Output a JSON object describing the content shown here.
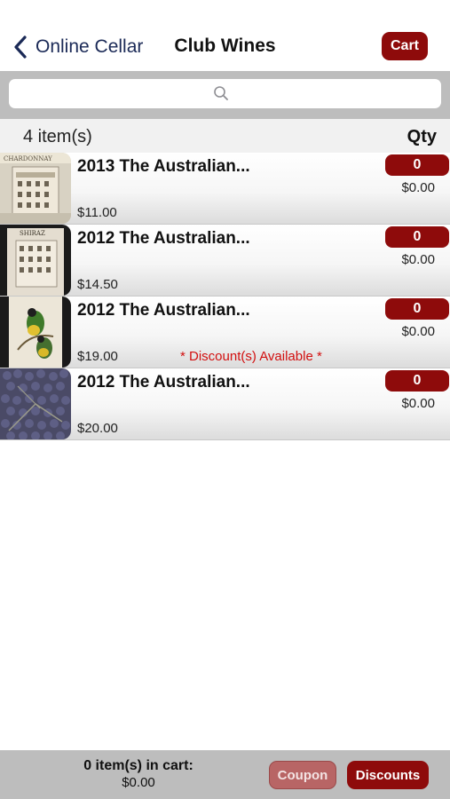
{
  "nav": {
    "back_label": "Online Cellar",
    "title": "Club Wines",
    "cart_label": "Cart"
  },
  "search": {
    "placeholder": ""
  },
  "list": {
    "count_label": "4 item(s)",
    "qty_header": "Qty",
    "items": [
      {
        "name": "2013 The Australian...",
        "price": "$11.00",
        "qty": "0",
        "line_total": "$0.00",
        "discount_note": "",
        "thumb": "chardonnay-label"
      },
      {
        "name": "2012 The Australian...",
        "price": "$14.50",
        "qty": "0",
        "line_total": "$0.00",
        "discount_note": "",
        "thumb": "shiraz-label"
      },
      {
        "name": "2012 The Australian...",
        "price": "$19.00",
        "qty": "0",
        "line_total": "$0.00",
        "discount_note": "* Discount(s) Available *",
        "thumb": "bird-label"
      },
      {
        "name": "2012 The Australian...",
        "price": "$20.00",
        "qty": "0",
        "line_total": "$0.00",
        "discount_note": "",
        "thumb": "grapes-photo"
      }
    ]
  },
  "footer": {
    "cart_count": "0 item(s) in cart:",
    "cart_total": "$0.00",
    "coupon_label": "Coupon",
    "discounts_label": "Discounts"
  },
  "colors": {
    "accent": "#8e0b0b",
    "nav_text": "#1b2a57",
    "discount_text": "#d20f0f"
  }
}
